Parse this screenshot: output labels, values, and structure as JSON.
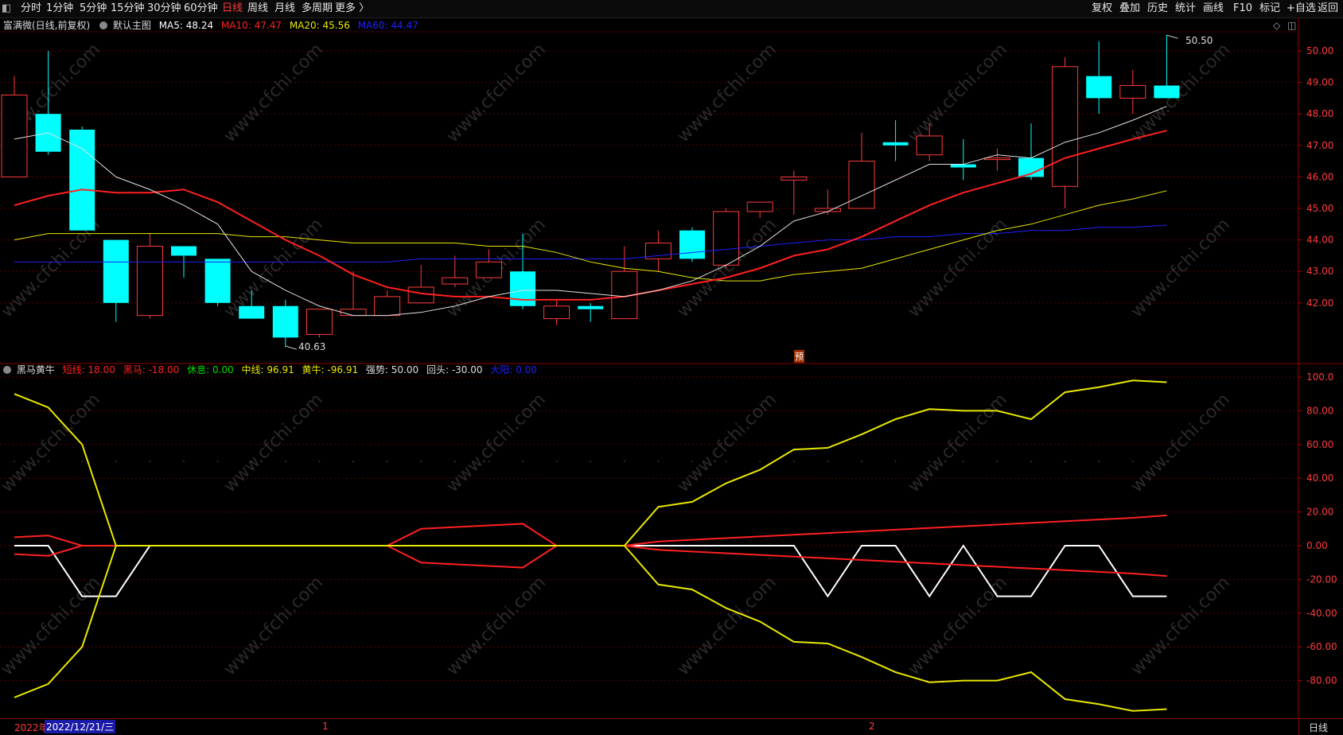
{
  "toolbar": {
    "left_items": [
      "分时",
      "1分钟",
      "5分钟",
      "15分钟",
      "30分钟",
      "60分钟",
      "日线",
      "周线",
      "月线",
      "多周期",
      "更多 〉"
    ],
    "active": "日线",
    "right_items": [
      "复权",
      "叠加",
      "历史",
      "统计",
      "画线",
      "F10",
      "标记",
      "+自选",
      "返回"
    ]
  },
  "main_legend": {
    "stock": "富满微(日线,前复权)",
    "template": "默认主图",
    "ma": [
      {
        "label": "MA5: 48.24",
        "color": "#ffffff"
      },
      {
        "label": "MA10: 47.47",
        "color": "#ff2020"
      },
      {
        "label": "MA20: 45.56",
        "color": "#e8e800"
      },
      {
        "label": "MA60: 44.47",
        "color": "#2020ff"
      }
    ]
  },
  "sub_legend": {
    "name": "黑马黄牛",
    "items": [
      {
        "label": "短线: 18.00",
        "color": "#ff2020"
      },
      {
        "label": "黑马: -18.00",
        "color": "#ff2020"
      },
      {
        "label": "休息: 0.00",
        "color": "#00dd00"
      },
      {
        "label": "中线: 96.91",
        "color": "#e8e800"
      },
      {
        "label": "黄牛: -96.91",
        "color": "#e8e800"
      },
      {
        "label": "强势: 50.00",
        "color": "#dddddd"
      },
      {
        "label": "回头: -30.00",
        "color": "#dddddd"
      },
      {
        "label": "大阳: 0.00",
        "color": "#2020ff"
      }
    ]
  },
  "price_axis": [
    "50.00",
    "49.00",
    "48.00",
    "47.00",
    "46.00",
    "45.00",
    "44.00",
    "43.00",
    "42.00"
  ],
  "ind_axis": [
    "100.0",
    "80.00",
    "60.00",
    "40.00",
    "20.00",
    "0.00",
    "-20.00",
    "-40.00",
    "-60.00",
    "-80.00"
  ],
  "annotations": {
    "high": "50.50",
    "low": "40.63",
    "pre_mark": "预"
  },
  "footer": {
    "year": "2022年",
    "date": "2022/12/21/三",
    "mark1": "1",
    "mark2": "2",
    "period": "日线"
  },
  "watermark": "www.cfchi.com",
  "colors": {
    "up": "#ff3b3b",
    "down": "#00ffff",
    "bg": "#000000",
    "grid": "#5a0000"
  },
  "chart_data": {
    "type": "candlestick",
    "candles": [
      {
        "o": 46.0,
        "c": 48.6,
        "h": 49.2,
        "l": 46.0
      },
      {
        "o": 48.0,
        "c": 46.8,
        "h": 50.0,
        "l": 46.7
      },
      {
        "o": 47.5,
        "c": 44.3,
        "h": 47.6,
        "l": 44.3
      },
      {
        "o": 44.0,
        "c": 42.0,
        "h": 44.0,
        "l": 41.4
      },
      {
        "o": 41.6,
        "c": 43.8,
        "h": 44.2,
        "l": 41.5
      },
      {
        "o": 43.8,
        "c": 43.5,
        "h": 43.8,
        "l": 42.8
      },
      {
        "o": 43.4,
        "c": 42.0,
        "h": 43.4,
        "l": 41.9
      },
      {
        "o": 41.9,
        "c": 41.5,
        "h": 42.4,
        "l": 41.5
      },
      {
        "o": 41.9,
        "c": 40.9,
        "h": 42.1,
        "l": 40.6
      },
      {
        "o": 41.0,
        "c": 41.8,
        "h": 41.8,
        "l": 40.9
      },
      {
        "o": 41.6,
        "c": 41.8,
        "h": 43.0,
        "l": 41.6
      },
      {
        "o": 41.6,
        "c": 42.2,
        "h": 42.4,
        "l": 41.6
      },
      {
        "o": 42.0,
        "c": 42.5,
        "h": 43.2,
        "l": 42.0
      },
      {
        "o": 42.6,
        "c": 42.8,
        "h": 43.5,
        "l": 42.5
      },
      {
        "o": 42.8,
        "c": 43.3,
        "h": 43.7,
        "l": 42.8
      },
      {
        "o": 43.0,
        "c": 41.9,
        "h": 44.2,
        "l": 41.8
      },
      {
        "o": 41.5,
        "c": 41.9,
        "h": 42.1,
        "l": 41.3
      },
      {
        "o": 41.9,
        "c": 41.8,
        "h": 42.0,
        "l": 41.4
      },
      {
        "o": 41.5,
        "c": 43.0,
        "h": 43.8,
        "l": 41.5
      },
      {
        "o": 43.4,
        "c": 43.9,
        "h": 44.3,
        "l": 43.0
      },
      {
        "o": 44.3,
        "c": 43.4,
        "h": 44.4,
        "l": 43.3
      },
      {
        "o": 43.2,
        "c": 44.9,
        "h": 45.0,
        "l": 43.1
      },
      {
        "o": 44.9,
        "c": 45.2,
        "h": 45.2,
        "l": 44.7
      },
      {
        "o": 45.9,
        "c": 46.0,
        "h": 46.2,
        "l": 44.8
      },
      {
        "o": 44.9,
        "c": 45.0,
        "h": 45.6,
        "l": 44.8
      },
      {
        "o": 45.0,
        "c": 46.5,
        "h": 47.4,
        "l": 45.0
      },
      {
        "o": 47.1,
        "c": 47.0,
        "h": 47.8,
        "l": 46.5
      },
      {
        "o": 46.7,
        "c": 47.3,
        "h": 47.7,
        "l": 46.5
      },
      {
        "o": 46.4,
        "c": 46.3,
        "h": 47.2,
        "l": 45.9
      },
      {
        "o": 46.6,
        "c": 46.6,
        "h": 46.9,
        "l": 46.2
      },
      {
        "o": 46.6,
        "c": 46.0,
        "h": 47.7,
        "l": 45.9
      },
      {
        "o": 45.7,
        "c": 49.5,
        "h": 49.8,
        "l": 45.0
      },
      {
        "o": 49.2,
        "c": 48.5,
        "h": 50.3,
        "l": 48.0
      },
      {
        "o": 48.5,
        "c": 48.9,
        "h": 49.4,
        "l": 48.0
      },
      {
        "o": 48.9,
        "c": 48.5,
        "h": 50.5,
        "l": 48.5
      }
    ],
    "ma5": [
      47.2,
      47.4,
      46.9,
      46.0,
      45.6,
      45.1,
      44.5,
      43.0,
      42.4,
      41.9,
      41.6,
      41.6,
      41.7,
      41.9,
      42.2,
      42.4,
      42.4,
      42.3,
      42.2,
      42.4,
      42.7,
      43.2,
      43.8,
      44.6,
      44.9,
      45.4,
      45.9,
      46.4,
      46.4,
      46.7,
      46.6,
      47.1,
      47.4,
      47.8,
      48.24
    ],
    "ma10": [
      45.1,
      45.4,
      45.6,
      45.5,
      45.5,
      45.6,
      45.2,
      44.6,
      44.0,
      43.5,
      42.9,
      42.5,
      42.3,
      42.2,
      42.2,
      42.1,
      42.1,
      42.1,
      42.2,
      42.4,
      42.6,
      42.8,
      43.1,
      43.5,
      43.7,
      44.1,
      44.6,
      45.1,
      45.5,
      45.8,
      46.1,
      46.6,
      46.9,
      47.2,
      47.47
    ],
    "ma20": [
      44.0,
      44.2,
      44.2,
      44.2,
      44.2,
      44.2,
      44.2,
      44.1,
      44.1,
      44.0,
      43.9,
      43.9,
      43.9,
      43.9,
      43.8,
      43.8,
      43.6,
      43.3,
      43.1,
      43.0,
      42.8,
      42.7,
      42.7,
      42.9,
      43.0,
      43.1,
      43.4,
      43.7,
      44.0,
      44.3,
      44.5,
      44.8,
      45.1,
      45.3,
      45.56
    ],
    "ma60": [
      43.3,
      43.3,
      43.3,
      43.3,
      43.3,
      43.3,
      43.3,
      43.3,
      43.3,
      43.3,
      43.3,
      43.3,
      43.4,
      43.4,
      43.4,
      43.4,
      43.4,
      43.4,
      43.4,
      43.5,
      43.6,
      43.7,
      43.8,
      43.9,
      44.0,
      44.0,
      44.1,
      44.1,
      44.2,
      44.2,
      44.3,
      44.3,
      44.4,
      44.4,
      44.47
    ],
    "zhongxian": [
      90,
      82,
      60,
      0,
      0,
      0,
      0,
      0,
      0,
      0,
      0,
      0,
      0,
      0,
      0,
      0,
      0,
      0,
      0,
      23,
      26,
      37,
      45,
      57,
      58,
      66,
      75,
      81,
      80,
      80,
      75,
      91,
      94,
      98,
      96.91
    ],
    "duanxian": [
      5,
      6,
      0,
      0,
      0,
      0,
      0,
      0,
      0,
      0,
      0,
      0,
      10,
      11,
      12,
      13,
      0,
      0,
      0,
      2.5,
      3.5,
      4.5,
      5.5,
      6.5,
      7.5,
      8.5,
      9.5,
      10.5,
      11.5,
      12.5,
      13.5,
      14.5,
      15.5,
      16.5,
      18
    ],
    "qiangshi": [
      0,
      0,
      -30,
      -30,
      0,
      0,
      0,
      0,
      0,
      0,
      0,
      0,
      0,
      0,
      0,
      0,
      0,
      0,
      0,
      0,
      0,
      0,
      0,
      0,
      -30,
      0,
      0,
      -30,
      0,
      -30,
      -30,
      0,
      0,
      -30,
      -30
    ]
  }
}
